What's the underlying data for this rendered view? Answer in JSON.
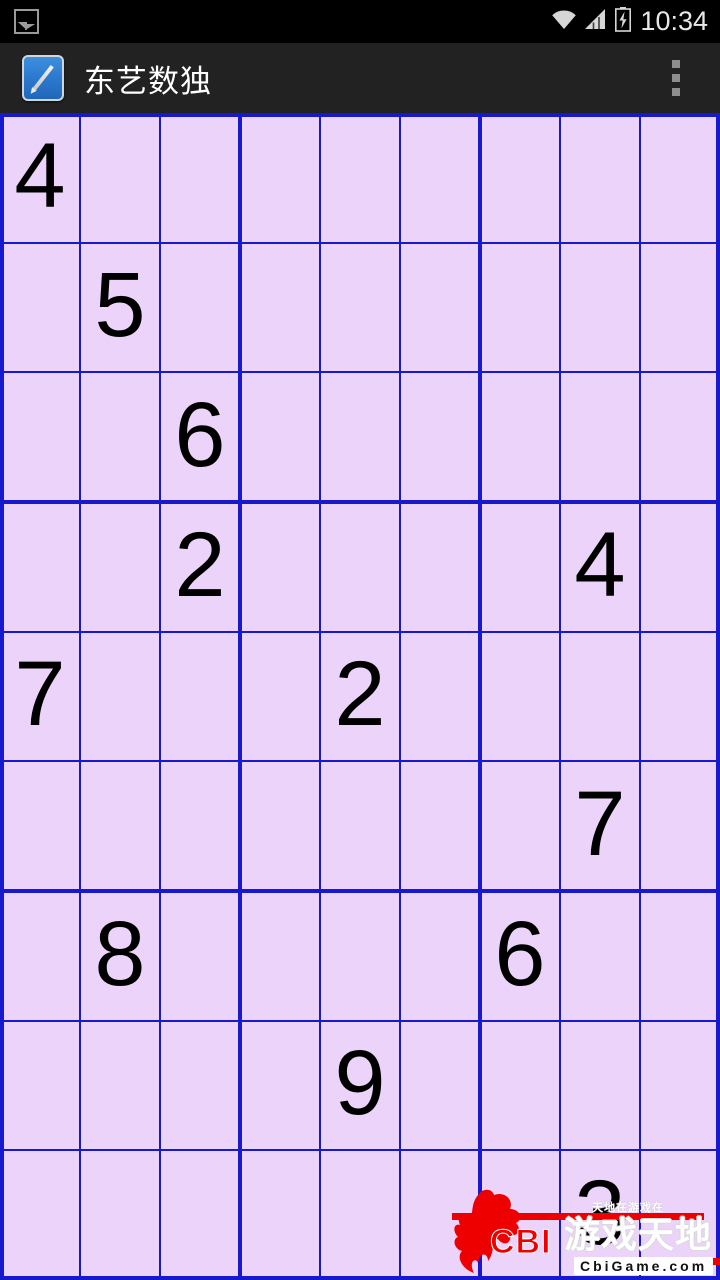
{
  "status_bar": {
    "notification_icon": "photo-icon",
    "wifi_icon": "wifi-icon",
    "signal_icon": "signal-bars-icon",
    "battery_icon": "battery-charging-icon",
    "clock": "10:34",
    "background_color": "#000000"
  },
  "action_bar": {
    "app_icon": "pencil-note-app-icon",
    "title": "东艺数独",
    "overflow_icon": "overflow-menu-icon",
    "background_color": "#222222",
    "text_color": "#FFFFFF"
  },
  "board": {
    "background_color": "#EBD3FA",
    "line_color": "#1818CC",
    "digit_color": "#000000",
    "size": 9,
    "cells": [
      [
        "4",
        "",
        "",
        "",
        "",
        "",
        "",
        "",
        ""
      ],
      [
        "",
        "5",
        "",
        "",
        "",
        "",
        "",
        "",
        ""
      ],
      [
        "",
        "",
        "6",
        "",
        "",
        "",
        "",
        "",
        ""
      ],
      [
        "",
        "",
        "2",
        "",
        "",
        "",
        "",
        "4",
        ""
      ],
      [
        "7",
        "",
        "",
        "",
        "2",
        "",
        "",
        "",
        ""
      ],
      [
        "",
        "",
        "",
        "",
        "",
        "",
        "",
        "7",
        ""
      ],
      [
        "",
        "8",
        "",
        "",
        "",
        "",
        "6",
        "",
        ""
      ],
      [
        "",
        "",
        "",
        "",
        "9",
        "",
        "",
        "",
        ""
      ],
      [
        "",
        "",
        "",
        "",
        "",
        "",
        "",
        "3",
        ""
      ]
    ]
  },
  "watermark": {
    "brand": "CBI",
    "chinese": "游戏天地",
    "tagline": "天地在游戏在",
    "url": "CbiGame.com",
    "brand_color": "#EE0000"
  }
}
